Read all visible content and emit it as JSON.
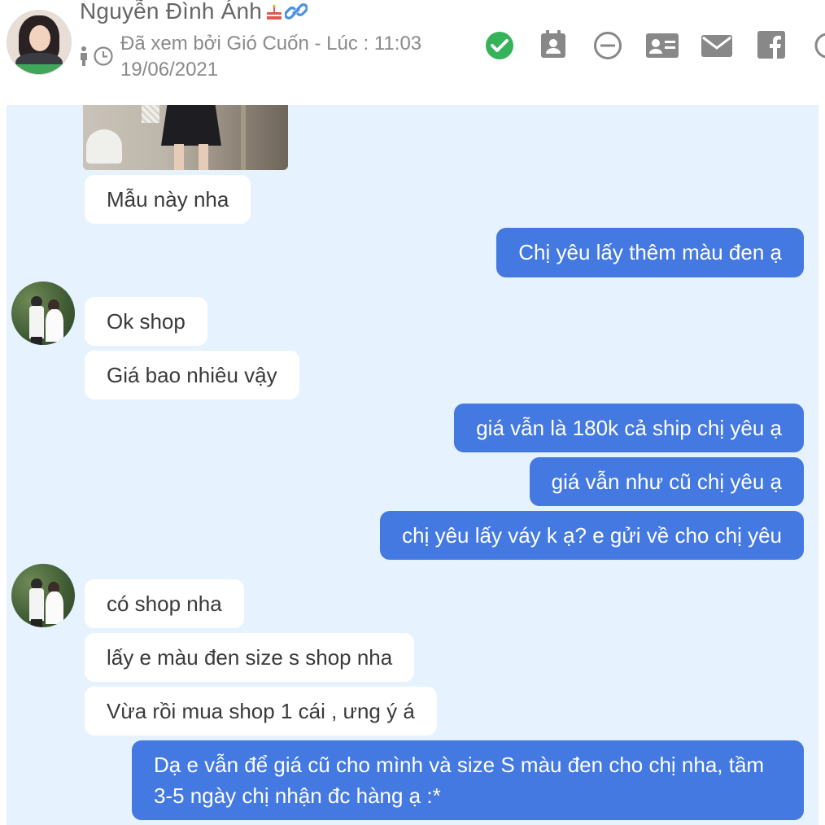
{
  "header": {
    "contact_name": "Nguyễn Đình Ánh",
    "seen_text": "Đã xem bởi Gió Cuốn - Lúc : 11:03",
    "seen_date": "19/06/2021",
    "icons": [
      "person-icon",
      "clock-icon",
      "check-circle-icon",
      "contact-card-icon",
      "block-icon",
      "id-card-icon",
      "mail-icon",
      "facebook-icon"
    ],
    "colors": {
      "check": "#34b35a",
      "icon_gray": "#888888",
      "link": "#4a90e2",
      "cake": "#e0564f"
    }
  },
  "chat": {
    "background": "#e6f2fd",
    "outgoing_color": "#4479e2",
    "messages": [
      {
        "direction": "in",
        "text": "Mẫu này nha"
      },
      {
        "direction": "out",
        "text": "Chị yêu lấy thêm màu đen ạ"
      },
      {
        "direction": "in",
        "text": "Ok shop"
      },
      {
        "direction": "in",
        "text": "Giá bao nhiêu vậy"
      },
      {
        "direction": "out",
        "text": "giá vẫn là 180k cả ship chị yêu ạ"
      },
      {
        "direction": "out",
        "text": "giá vẫn như cũ chị yêu ạ"
      },
      {
        "direction": "out",
        "text": "chị yêu lấy váy k ạ? e gửi về cho chị yêu"
      },
      {
        "direction": "in",
        "text": "có shop nha"
      },
      {
        "direction": "in",
        "text": "lấy e màu đen size s shop nha"
      },
      {
        "direction": "in",
        "text": "Vừa rồi mua shop 1 cái , ưng ý á"
      },
      {
        "direction": "out",
        "text": "Dạ e vẫn để giá cũ cho mình và size S màu đen cho chị nha, tầm 3-5 ngày chị nhận đc hàng ạ :*"
      }
    ]
  }
}
